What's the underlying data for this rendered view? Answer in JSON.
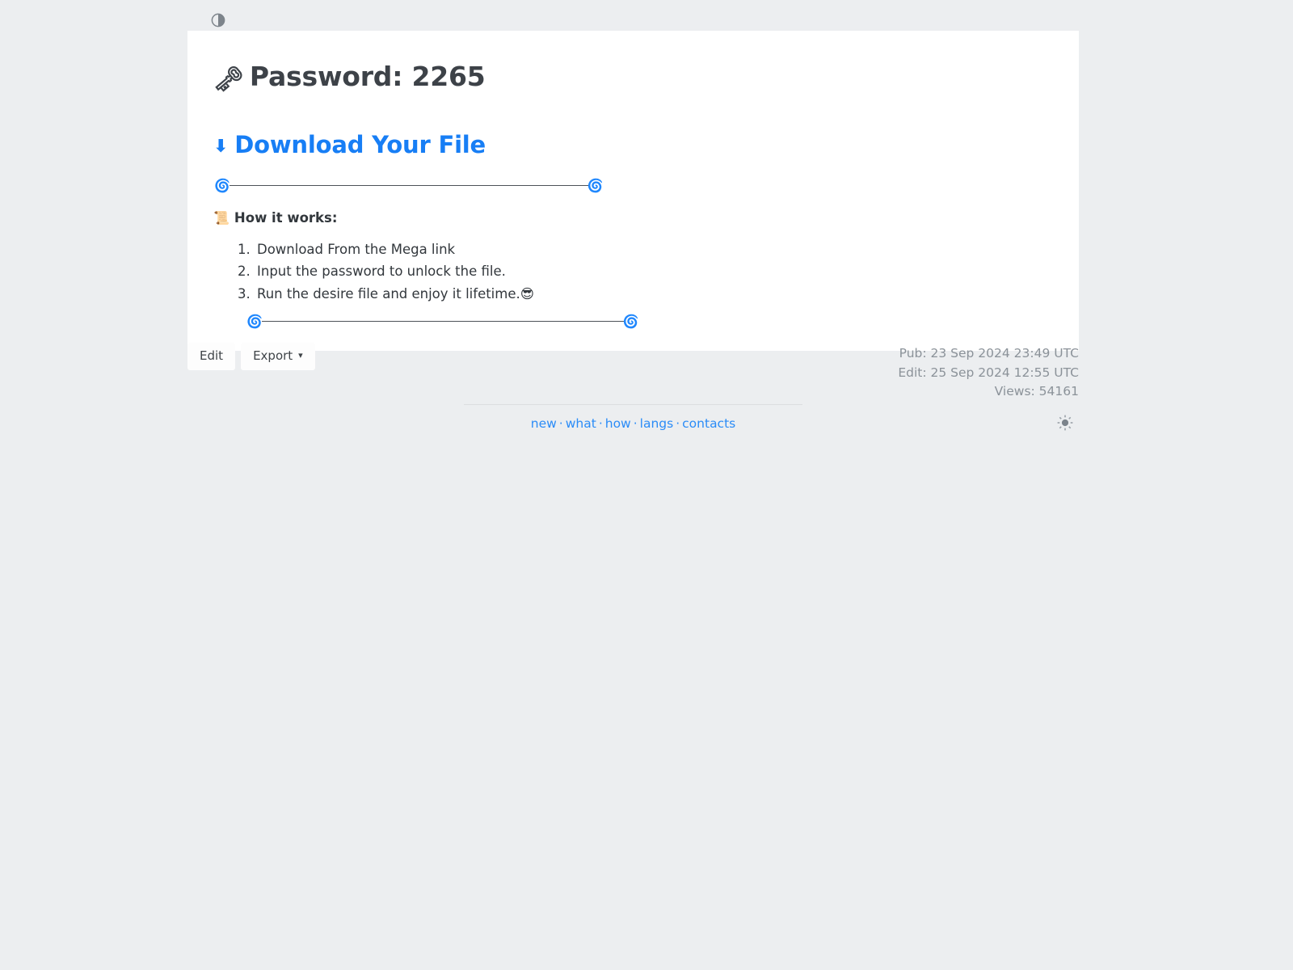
{
  "theme": {
    "top_toggle_icon": "contrast-circle-icon",
    "bottom_toggle_icon": "sun-icon",
    "accent_color": "#177ef5",
    "link_color": "#2b8cf7",
    "page_background": "#eceef0",
    "card_background": "#ffffff",
    "heading_color": "#3d4248",
    "muted_text_color": "#8b9299"
  },
  "note": {
    "title_emoji": "🗝",
    "title": "Password: 2265",
    "download": {
      "arrow_glyph": "⬇",
      "label": "Download Your File"
    },
    "divider_emoji": "🌀",
    "howto": {
      "emoji": "📜",
      "heading": "How it works:",
      "steps": [
        "Download From the Mega link",
        "Input the password to unlock the file.",
        "Run the desire file and enjoy it lifetime.😎"
      ]
    }
  },
  "toolbar": {
    "edit_label": "Edit",
    "export_label": "Export",
    "export_caret": "▾"
  },
  "meta": {
    "published": "Pub: 23 Sep 2024 23:49 UTC",
    "edited": "Edit: 25 Sep 2024 12:55 UTC",
    "views": "Views: 54161"
  },
  "footer": {
    "separator": "·",
    "links": [
      {
        "label": "new"
      },
      {
        "label": "what"
      },
      {
        "label": "how"
      },
      {
        "label": "langs"
      },
      {
        "label": "contacts"
      }
    ]
  }
}
